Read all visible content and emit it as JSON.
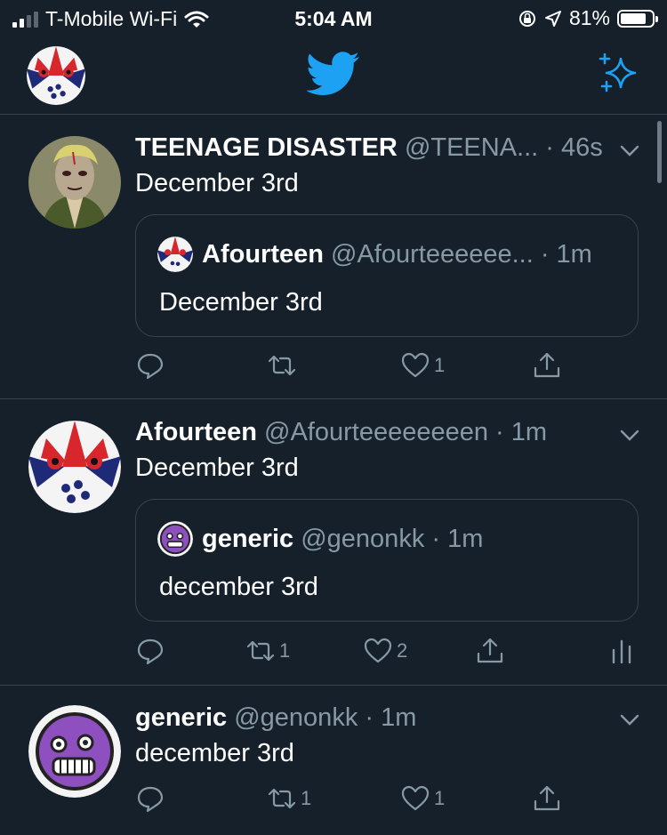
{
  "status_bar": {
    "carrier": "T-Mobile Wi-Fi",
    "time": "5:04 AM",
    "battery": "81%",
    "battery_level": 0.81
  },
  "header": {
    "logo_icon": "bird-icon",
    "sparkle_icon": "sparkle-icon",
    "accent_color": "#1da1f2"
  },
  "tweets": [
    {
      "name": "TEENAGE DISASTER",
      "handle": "@TEENA...",
      "time": "· 46s",
      "text": "December 3rd",
      "quote": {
        "name": "Afourteen",
        "handle": "@Afourteeeeee...",
        "time": "· 1m",
        "text": "December 3rd"
      },
      "actions": {
        "reply": "",
        "retweet": "",
        "like": "1"
      }
    },
    {
      "name": "Afourteen",
      "handle": "@Afourteeeeeeeen",
      "time": "· 1m",
      "text": "December 3rd",
      "quote": {
        "name": "generic",
        "handle": "@genonkk",
        "time": "· 1m",
        "text": "december 3rd"
      },
      "actions": {
        "reply": "",
        "retweet": "1",
        "like": "2"
      }
    },
    {
      "name": "generic",
      "handle": "@genonkk",
      "time": "· 1m",
      "text": "december 3rd",
      "actions": {
        "reply": "",
        "retweet": "1",
        "like": "1"
      }
    }
  ]
}
